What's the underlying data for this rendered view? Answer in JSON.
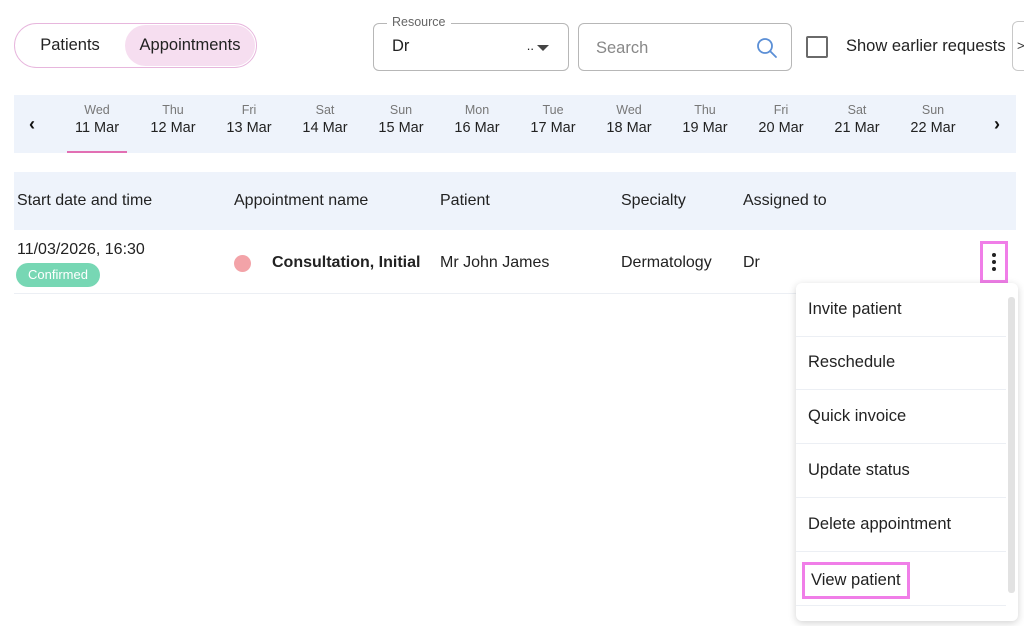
{
  "toggle": {
    "patients": "Patients",
    "appointments": "Appointments",
    "active": "appointments"
  },
  "resource": {
    "legend": "Resource",
    "value": "Dr",
    "truncation": ".."
  },
  "search": {
    "placeholder": "Search"
  },
  "show_earlier": {
    "label": "Show earlier requests",
    "checked": false
  },
  "edge_button": {
    "label": ">"
  },
  "dates": {
    "prev": "‹",
    "next": "›",
    "days": [
      {
        "dow": "Wed",
        "dm": "11 Mar",
        "selected": true
      },
      {
        "dow": "Thu",
        "dm": "12 Mar"
      },
      {
        "dow": "Fri",
        "dm": "13 Mar"
      },
      {
        "dow": "Sat",
        "dm": "14 Mar"
      },
      {
        "dow": "Sun",
        "dm": "15 Mar"
      },
      {
        "dow": "Mon",
        "dm": "16 Mar"
      },
      {
        "dow": "Tue",
        "dm": "17 Mar"
      },
      {
        "dow": "Wed",
        "dm": "18 Mar"
      },
      {
        "dow": "Thu",
        "dm": "19 Mar"
      },
      {
        "dow": "Fri",
        "dm": "20 Mar"
      },
      {
        "dow": "Sat",
        "dm": "21 Mar"
      },
      {
        "dow": "Sun",
        "dm": "22 Mar"
      }
    ]
  },
  "table": {
    "headers": [
      "Start date and time",
      "Appointment name",
      "Patient",
      "Specialty",
      "Assigned to"
    ],
    "rows": [
      {
        "start": "11/03/2026, 16:30",
        "status": "Confirmed",
        "name": "Consultation, Initial",
        "patient": "Mr John James",
        "specialty": "Dermatology",
        "assigned": "Dr"
      }
    ]
  },
  "menu": {
    "items": [
      "Invite patient",
      "Reschedule",
      "Quick invoice",
      "Update status",
      "Delete appointment",
      "View patient"
    ],
    "highlighted": "View patient"
  },
  "colors": {
    "accent_pink": "#f07ee8",
    "toggle_active": "#f6def0",
    "status_confirmed": "#77d7b4",
    "appointment_dot": "#f3a3a8",
    "strip_bg": "#eef3fb"
  }
}
